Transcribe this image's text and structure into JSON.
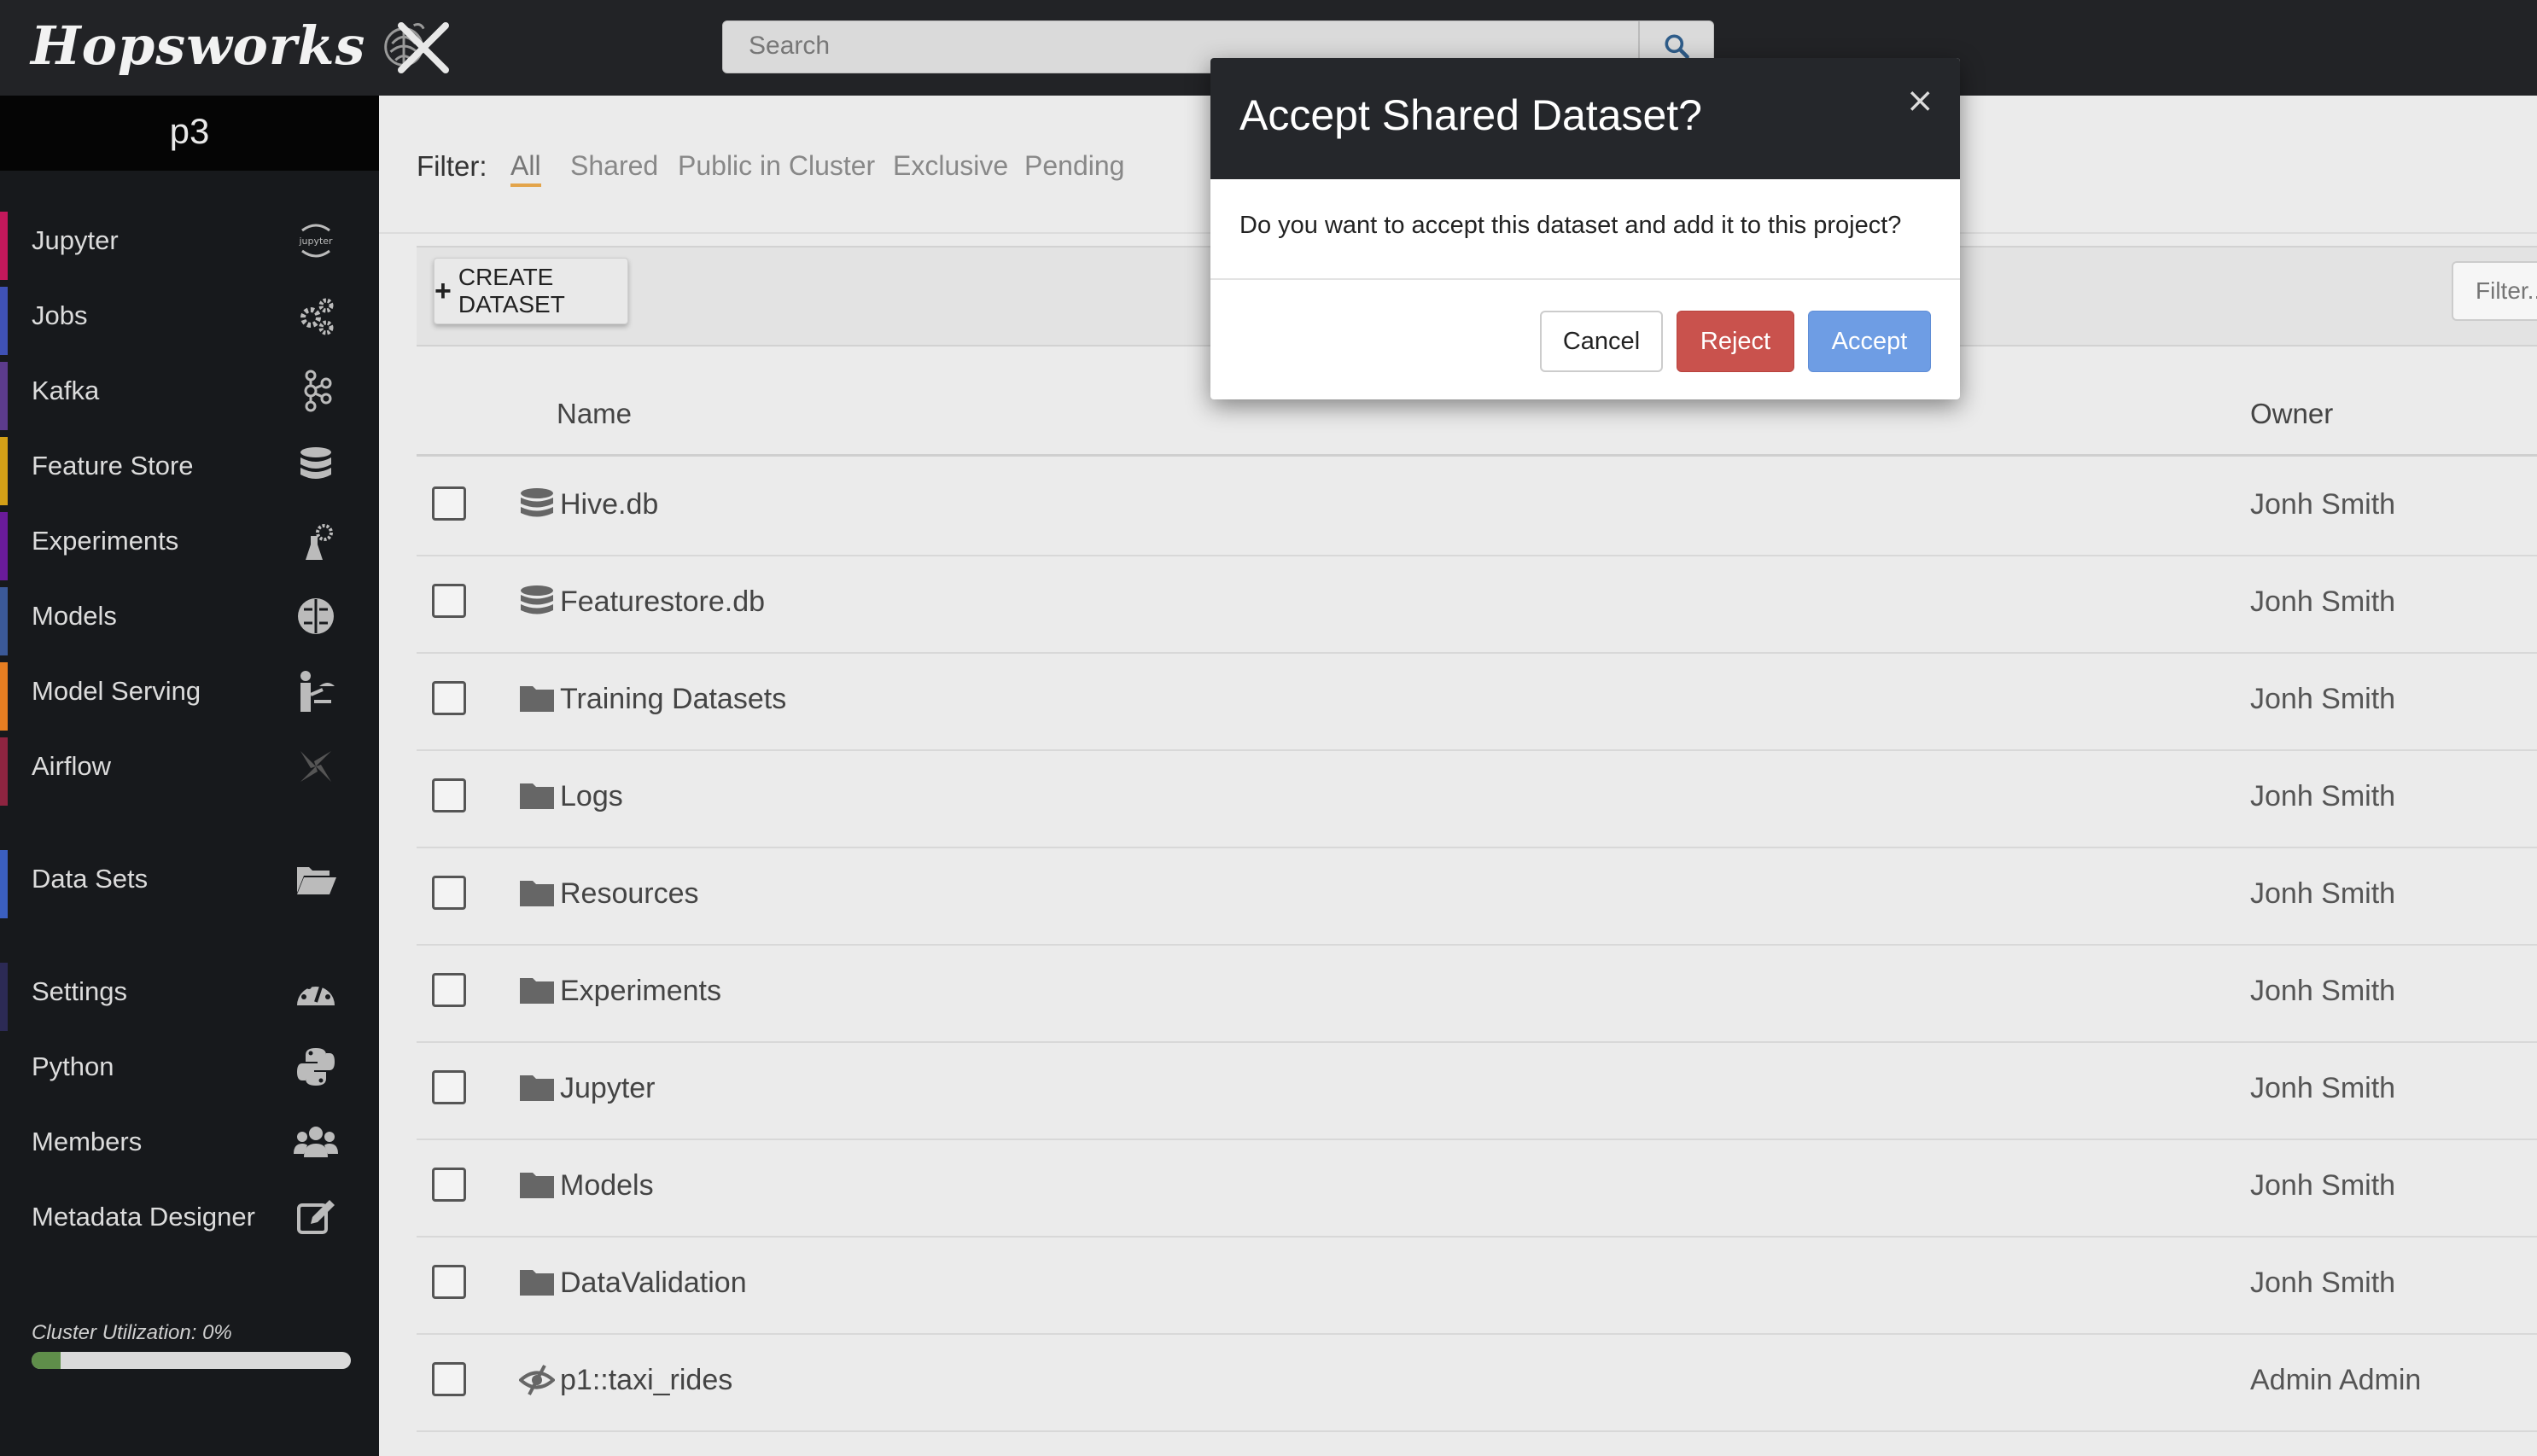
{
  "app": {
    "name": "Hopsworks"
  },
  "search": {
    "placeholder": "Search"
  },
  "project": {
    "name": "p3"
  },
  "sidebar": {
    "items": [
      {
        "label": "Jupyter",
        "icon": "jupyter-icon",
        "accent": "#c2185b"
      },
      {
        "label": "Jobs",
        "icon": "gears-icon",
        "accent": "#3f51b5"
      },
      {
        "label": "Kafka",
        "icon": "kafka-icon",
        "accent": "#5c3b8c"
      },
      {
        "label": "Feature Store",
        "icon": "database-icon",
        "accent": "#d4a017"
      },
      {
        "label": "Experiments",
        "icon": "flask-icon",
        "accent": "#6a1b9a"
      },
      {
        "label": "Models",
        "icon": "brain-icon",
        "accent": "#3b5998"
      },
      {
        "label": "Model Serving",
        "icon": "serving-icon",
        "accent": "#e67e22"
      },
      {
        "label": "Airflow",
        "icon": "pinwheel-icon",
        "accent": "#8e2440"
      },
      {
        "label": "Data Sets",
        "icon": "folder-open-icon",
        "accent": "#3b5fc0"
      },
      {
        "label": "Settings",
        "icon": "dashboard-icon",
        "accent": "#2c2a55"
      },
      {
        "label": "Python",
        "icon": "python-icon",
        "accent": "#17191c"
      },
      {
        "label": "Members",
        "icon": "users-icon",
        "accent": "#17191c"
      },
      {
        "label": "Metadata Designer",
        "icon": "edit-icon",
        "accent": "#17191c"
      }
    ],
    "utilization": {
      "label": "Cluster Utilization: 0%",
      "value_percent": 0
    }
  },
  "filters": {
    "label": "Filter:",
    "options": [
      "All",
      "Shared",
      "Public in Cluster",
      "Exclusive",
      "Pending"
    ],
    "active": "All",
    "search_placeholder": "Filter..."
  },
  "toolbar": {
    "create_label": "CREATE DATASET"
  },
  "table": {
    "headers": {
      "name": "Name",
      "owner": "Owner"
    },
    "rows": [
      {
        "name": "Hive.db",
        "icon": "database-icon",
        "owner": "Jonh Smith"
      },
      {
        "name": "Featurestore.db",
        "icon": "database-icon",
        "owner": "Jonh Smith"
      },
      {
        "name": "Training Datasets",
        "icon": "folder-icon",
        "owner": "Jonh Smith"
      },
      {
        "name": "Logs",
        "icon": "folder-icon",
        "owner": "Jonh Smith"
      },
      {
        "name": "Resources",
        "icon": "folder-icon",
        "owner": "Jonh Smith"
      },
      {
        "name": "Experiments",
        "icon": "folder-icon",
        "owner": "Jonh Smith"
      },
      {
        "name": "Jupyter",
        "icon": "folder-icon",
        "owner": "Jonh Smith"
      },
      {
        "name": "Models",
        "icon": "folder-icon",
        "owner": "Jonh Smith"
      },
      {
        "name": "DataValidation",
        "icon": "folder-icon",
        "owner": "Jonh Smith"
      },
      {
        "name": "p1::taxi_rides",
        "icon": "eye-slash-icon",
        "owner": "Admin Admin"
      }
    ]
  },
  "modal": {
    "title": "Accept Shared Dataset?",
    "close": "×",
    "message": "Do you want to accept this dataset and add it to this project?",
    "buttons": {
      "cancel": "Cancel",
      "reject": "Reject",
      "accept": "Accept"
    },
    "colors": {
      "reject": "#c9524d",
      "accept": "#6e9de4"
    }
  }
}
